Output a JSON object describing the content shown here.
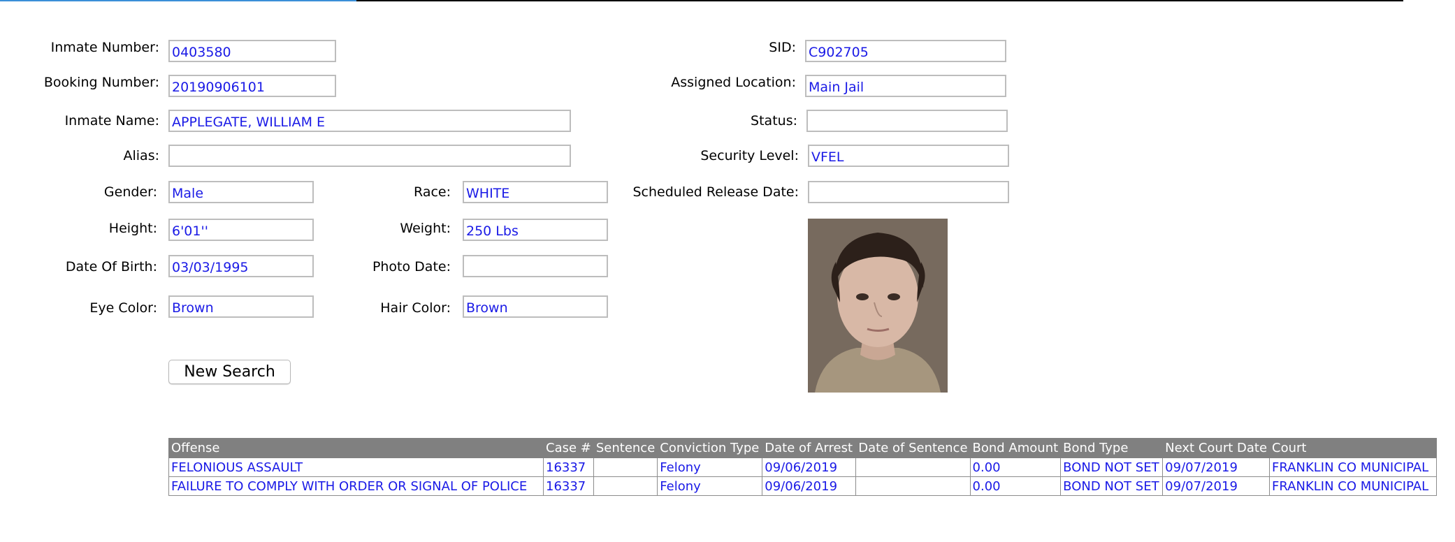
{
  "form": {
    "inmate_number": {
      "label": "Inmate Number:",
      "value": "0403580"
    },
    "booking_number": {
      "label": "Booking Number:",
      "value": "20190906101"
    },
    "inmate_name": {
      "label": "Inmate Name:",
      "value": "APPLEGATE, WILLIAM E"
    },
    "alias": {
      "label": "Alias:",
      "value": ""
    },
    "gender": {
      "label": "Gender:",
      "value": "Male"
    },
    "race": {
      "label": "Race:",
      "value": "WHITE"
    },
    "height": {
      "label": "Height:",
      "value": "6'01''"
    },
    "weight": {
      "label": "Weight:",
      "value": "250 Lbs"
    },
    "dob": {
      "label": "Date Of Birth:",
      "value": "03/03/1995"
    },
    "photo_date": {
      "label": "Photo Date:",
      "value": ""
    },
    "eye_color": {
      "label": "Eye Color:",
      "value": "Brown"
    },
    "hair_color": {
      "label": "Hair Color:",
      "value": "Brown"
    },
    "sid": {
      "label": "SID:",
      "value": "C902705"
    },
    "assigned_location": {
      "label": "Assigned Location:",
      "value": "Main Jail"
    },
    "status": {
      "label": "Status:",
      "value": ""
    },
    "security_level": {
      "label": "Security Level:",
      "value": "VFEL"
    },
    "scheduled_release": {
      "label": "Scheduled Release Date:",
      "value": ""
    }
  },
  "new_search_label": "New Search",
  "offenses": {
    "headers": [
      "Offense",
      "Case #",
      "Sentence",
      "Conviction Type",
      "Date of Arrest",
      "Date of Sentence",
      "Bond Amount",
      "Bond Type",
      "Next Court Date",
      "Court"
    ],
    "rows": [
      [
        "FELONIOUS ASSAULT",
        "16337",
        "",
        "Felony",
        "09/06/2019",
        "",
        "0.00",
        "BOND NOT SET",
        "09/07/2019",
        "FRANKLIN CO MUNICIPAL"
      ],
      [
        "FAILURE TO COMPLY WITH ORDER OR SIGNAL OF POLICE",
        "16337",
        "",
        "Felony",
        "09/06/2019",
        "",
        "0.00",
        "BOND NOT SET",
        "09/07/2019",
        "FRANKLIN CO MUNICIPAL"
      ]
    ]
  }
}
